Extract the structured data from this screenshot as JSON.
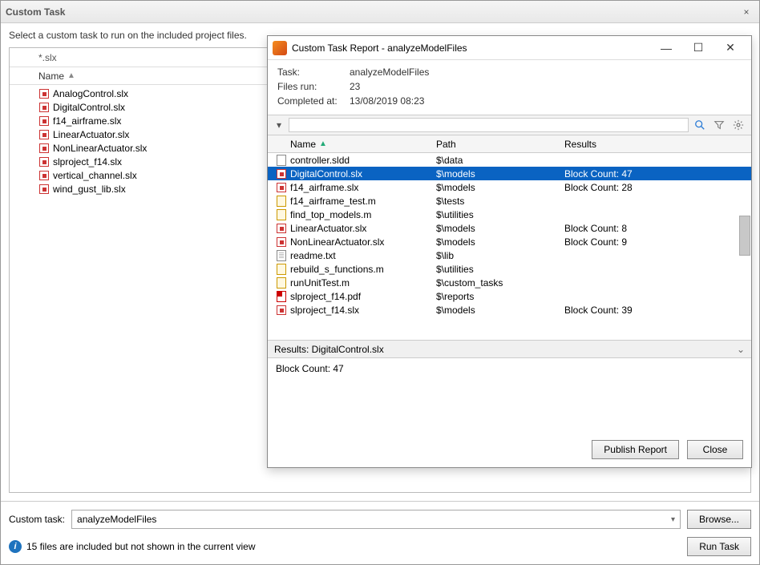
{
  "window": {
    "title": "Custom Task",
    "close": "×"
  },
  "instruction": "Select a custom task to run on the included project files.",
  "filter_text": "*.slx",
  "name_header": "Name",
  "files": [
    "AnalogControl.slx",
    "DigitalControl.slx",
    "f14_airframe.slx",
    "LinearActuator.slx",
    "NonLinearActuator.slx",
    "slproject_f14.slx",
    "vertical_channel.slx",
    "wind_gust_lib.slx"
  ],
  "custom_task_label": "Custom task:",
  "custom_task_value": "analyzeModelFiles",
  "browse_label": "Browse...",
  "status_text": "15 files are included but not shown in the current view",
  "run_task_label": "Run Task",
  "report": {
    "title": "Custom Task Report - analyzeModelFiles",
    "min": "—",
    "max": "☐",
    "close": "✕",
    "summary": {
      "task_label": "Task:",
      "task_value": "analyzeModelFiles",
      "files_run_label": "Files run:",
      "files_run_value": "23",
      "completed_label": "Completed at:",
      "completed_value": "13/08/2019 08:23"
    },
    "columns": {
      "name": "Name",
      "path": "Path",
      "results": "Results"
    },
    "rows": [
      {
        "icon": "sldd",
        "name": "controller.sldd",
        "path": "$\\data",
        "results": "",
        "selected": false
      },
      {
        "icon": "slx",
        "name": "DigitalControl.slx",
        "path": "$\\models",
        "results": "Block Count: 47",
        "selected": true
      },
      {
        "icon": "slx",
        "name": "f14_airframe.slx",
        "path": "$\\models",
        "results": "Block Count: 28",
        "selected": false
      },
      {
        "icon": "m",
        "name": "f14_airframe_test.m",
        "path": "$\\tests",
        "results": "",
        "selected": false
      },
      {
        "icon": "m",
        "name": "find_top_models.m",
        "path": "$\\utilities",
        "results": "",
        "selected": false
      },
      {
        "icon": "slx",
        "name": "LinearActuator.slx",
        "path": "$\\models",
        "results": "Block Count: 8",
        "selected": false
      },
      {
        "icon": "slx",
        "name": "NonLinearActuator.slx",
        "path": "$\\models",
        "results": "Block Count: 9",
        "selected": false
      },
      {
        "icon": "doc",
        "name": "readme.txt",
        "path": "$\\lib",
        "results": "",
        "selected": false
      },
      {
        "icon": "m",
        "name": "rebuild_s_functions.m",
        "path": "$\\utilities",
        "results": "",
        "selected": false
      },
      {
        "icon": "m",
        "name": "runUnitTest.m",
        "path": "$\\custom_tasks",
        "results": "",
        "selected": false
      },
      {
        "icon": "pdf",
        "name": "slproject_f14.pdf",
        "path": "$\\reports",
        "results": "",
        "selected": false
      },
      {
        "icon": "slx",
        "name": "slproject_f14.slx",
        "path": "$\\models",
        "results": "Block Count: 39",
        "selected": false
      }
    ],
    "results_header": "Results: DigitalControl.slx",
    "results_body": "Block Count: 47",
    "publish_label": "Publish Report",
    "close_label": "Close"
  }
}
